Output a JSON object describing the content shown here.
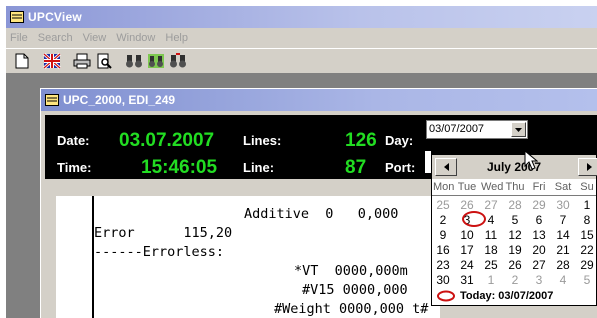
{
  "app": {
    "title": "UPCView"
  },
  "menu": [
    "File",
    "Search",
    "View",
    "Window",
    "Help"
  ],
  "toolbar": {
    "icons": [
      "new-document-icon",
      "flag-icon",
      "printer-icon",
      "print-preview-icon",
      "find-icon",
      "find-next-icon",
      "find-previous-icon"
    ]
  },
  "child_window": {
    "title": "UPC_2000, EDI_249"
  },
  "info": {
    "date_label": "Date:",
    "date_value": "03.07.2007",
    "lines_label": "Lines:",
    "lines_value": "126",
    "day_label": "Day:",
    "day_value": "03/07/2007",
    "time_label": "Time:",
    "time_value": "15:46:05",
    "line_label": "Line:",
    "line_value": "87",
    "port_label": "Port:"
  },
  "document": {
    "lines": [
      "Additive  0   0,000",
      "Error      115,20",
      "------Errorless:",
      "*VT  0000,000m",
      "#V15 0000,000",
      "#Weight 0000,000 t#"
    ]
  },
  "calendar": {
    "month_label": "July 2007",
    "weekdays": [
      "Mon",
      "Tue",
      "Wed",
      "Thu",
      "Fri",
      "Sat",
      "Su"
    ],
    "weeks": [
      [
        "25",
        "26",
        "27",
        "28",
        "29",
        "30",
        "1"
      ],
      [
        "2",
        "3",
        "4",
        "5",
        "6",
        "7",
        "8"
      ],
      [
        "9",
        "10",
        "11",
        "12",
        "13",
        "14",
        "15"
      ],
      [
        "16",
        "17",
        "18",
        "19",
        "20",
        "21",
        "22"
      ],
      [
        "23",
        "24",
        "25",
        "26",
        "27",
        "28",
        "29"
      ],
      [
        "30",
        "31",
        "1",
        "2",
        "3",
        "4",
        "5"
      ]
    ],
    "other_month": [
      [
        true,
        true,
        true,
        true,
        true,
        true,
        false
      ],
      [
        false,
        false,
        false,
        false,
        false,
        false,
        false
      ],
      [
        false,
        false,
        false,
        false,
        false,
        false,
        false
      ],
      [
        false,
        false,
        false,
        false,
        false,
        false,
        false
      ],
      [
        false,
        false,
        false,
        false,
        false,
        false,
        false
      ],
      [
        false,
        false,
        true,
        true,
        true,
        true,
        true
      ]
    ],
    "today_label": "Today: 03/07/2007",
    "selected_day": "3"
  },
  "colors": {
    "value_green": "#22dd22",
    "title_gradient": "#8a96d6",
    "today_circle": "#cc1111"
  }
}
